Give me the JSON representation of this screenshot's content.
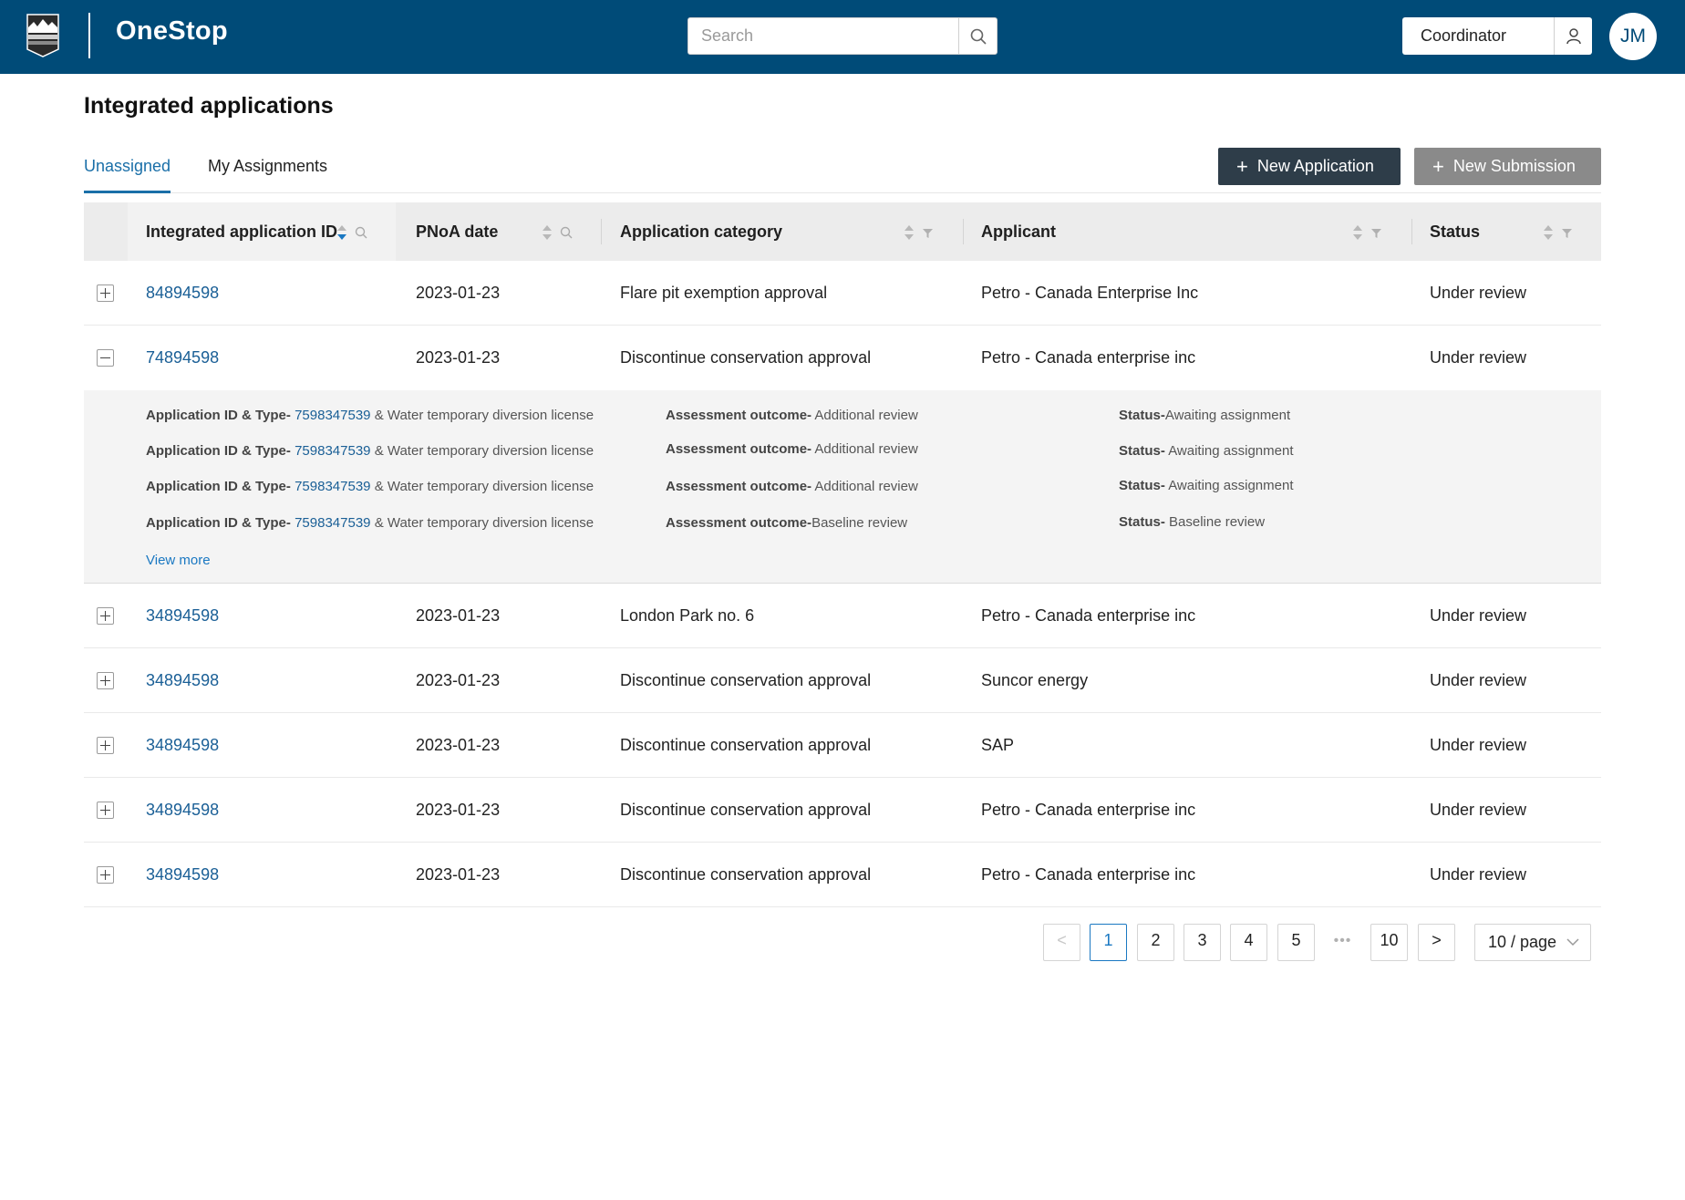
{
  "app": {
    "logo_prefix": "O",
    "logo_rest": "neStop",
    "search_placeholder": "Search",
    "role": "Coordinator",
    "avatar_initials": "JM"
  },
  "page": {
    "title": "Integrated applications"
  },
  "tabs": [
    {
      "label": "Unassigned",
      "active": true
    },
    {
      "label": "My Assignments",
      "active": false
    }
  ],
  "actions": {
    "new_application": "New Application",
    "new_submission": "New Submission"
  },
  "table": {
    "columns": [
      {
        "label": "Integrated application ID"
      },
      {
        "label": "PNoA date"
      },
      {
        "label": "Application category"
      },
      {
        "label": "Applicant"
      },
      {
        "label": "Status"
      }
    ],
    "rows": [
      {
        "id": "84894598",
        "date": "2023-01-23",
        "category": "Flare pit exemption approval",
        "applicant": "Petro - Canada Enterprise Inc",
        "status": "Under review",
        "expanded": false
      },
      {
        "id": "74894598",
        "date": "2023-01-23",
        "category": "Discontinue conservation approval",
        "applicant": "Petro - Canada enterprise inc",
        "status": "Under review",
        "expanded": true
      },
      {
        "id": "34894598",
        "date": "2023-01-23",
        "category": "London Park no. 6",
        "applicant": "Petro - Canada enterprise inc",
        "status": "Under review",
        "expanded": false
      },
      {
        "id": "34894598",
        "date": "2023-01-23",
        "category": "Discontinue conservation approval",
        "applicant": "Suncor energy",
        "status": "Under review",
        "expanded": false
      },
      {
        "id": "34894598",
        "date": "2023-01-23",
        "category": "Discontinue conservation approval",
        "applicant": "SAP",
        "status": "Under review",
        "expanded": false
      },
      {
        "id": "34894598",
        "date": "2023-01-23",
        "category": "Discontinue conservation approval",
        "applicant": "Petro - Canada enterprise inc",
        "status": "Under review",
        "expanded": false
      },
      {
        "id": "34894598",
        "date": "2023-01-23",
        "category": "Discontinue conservation approval",
        "applicant": "Petro - Canada enterprise inc",
        "status": "Under review",
        "expanded": false
      }
    ],
    "detail": {
      "items": [
        {
          "type_label": "Application ID & Type-",
          "app_id": "7598347539",
          "type_text": "& Water temporary diversion license",
          "outcome_label": "Assessment outcome-",
          "outcome": "Additional review",
          "status_label": "Status-",
          "status": "Awaiting assignment"
        },
        {
          "type_label": "Application ID & Type-",
          "app_id": "7598347539",
          "type_text": "& Water temporary diversion license",
          "outcome_label": "Assessment outcome-",
          "outcome": "Additional review",
          "status_label": "Status-",
          "status": "Awaiting assignment"
        },
        {
          "type_label": "Application ID & Type-",
          "app_id": "7598347539",
          "type_text": "& Water temporary diversion license",
          "outcome_label": "Assessment outcome-",
          "outcome": "Additional review",
          "status_label": "Status-",
          "status": "Awaiting assignment"
        },
        {
          "type_label": "Application ID & Type-",
          "app_id": "7598347539",
          "type_text": "& Water temporary diversion license",
          "outcome_label": "Assessment outcome-",
          "outcome": "Baseline review",
          "status_label": "Status-",
          "status": "Baseline review"
        }
      ],
      "view_more": "View more"
    }
  },
  "pagination": {
    "prev": "<",
    "next": ">",
    "pages": [
      "1",
      "2",
      "3",
      "4",
      "5"
    ],
    "ellipsis": "•••",
    "last": "10",
    "current": "1",
    "page_size": "10 / page"
  }
}
